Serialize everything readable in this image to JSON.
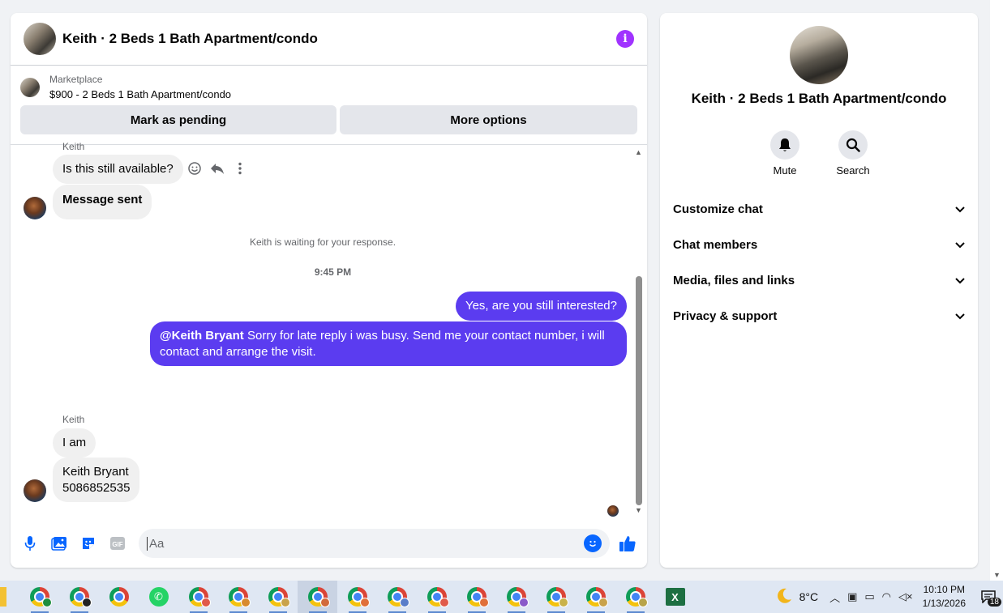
{
  "chat": {
    "title": "Keith · 2 Beds 1 Bath Apartment/condo",
    "info_icon": "i",
    "marketplace_label": "Marketplace",
    "listing_price_title": "$900 - 2 Beds 1 Bath Apartment/condo",
    "mark_pending_label": "Mark as pending",
    "more_options_label": "More options"
  },
  "messages": {
    "sender_top": "Keith",
    "msg1": "Is this still available?",
    "msg2": "Message sent",
    "system_note": "Keith is waiting for your response.",
    "time": "9:45 PM",
    "out1": "Yes, are you still interested?",
    "out2_mention": "@Keith Bryant",
    "out2_text": " Sorry for late reply i was busy. Send me your contact number, i will contact and arrange the visit.",
    "sender_bottom": "Keith",
    "msg3": "I am",
    "msg4_line1": "Keith Bryant",
    "msg4_line2": "5086852535"
  },
  "composer": {
    "placeholder": "Aa",
    "icons": [
      "mic-icon",
      "image-icon",
      "sticker-icon",
      "gif-icon",
      "emoji-icon",
      "like-icon"
    ],
    "gif_label": "GIF"
  },
  "info_panel": {
    "title": "Keith · 2 Beds 1 Bath Apartment/condo",
    "mute_label": "Mute",
    "search_label": "Search",
    "sections": [
      "Customize chat",
      "Chat members",
      "Media, files and links",
      "Privacy & support"
    ]
  },
  "taskbar": {
    "temperature": "8°C",
    "time": "10:10 PM",
    "date": "1/13/2026",
    "notifications": "18"
  },
  "colors": {
    "accent": "#5b3cf0",
    "messenger_blue": "#0866ff",
    "info_purple": "#a033ff"
  }
}
